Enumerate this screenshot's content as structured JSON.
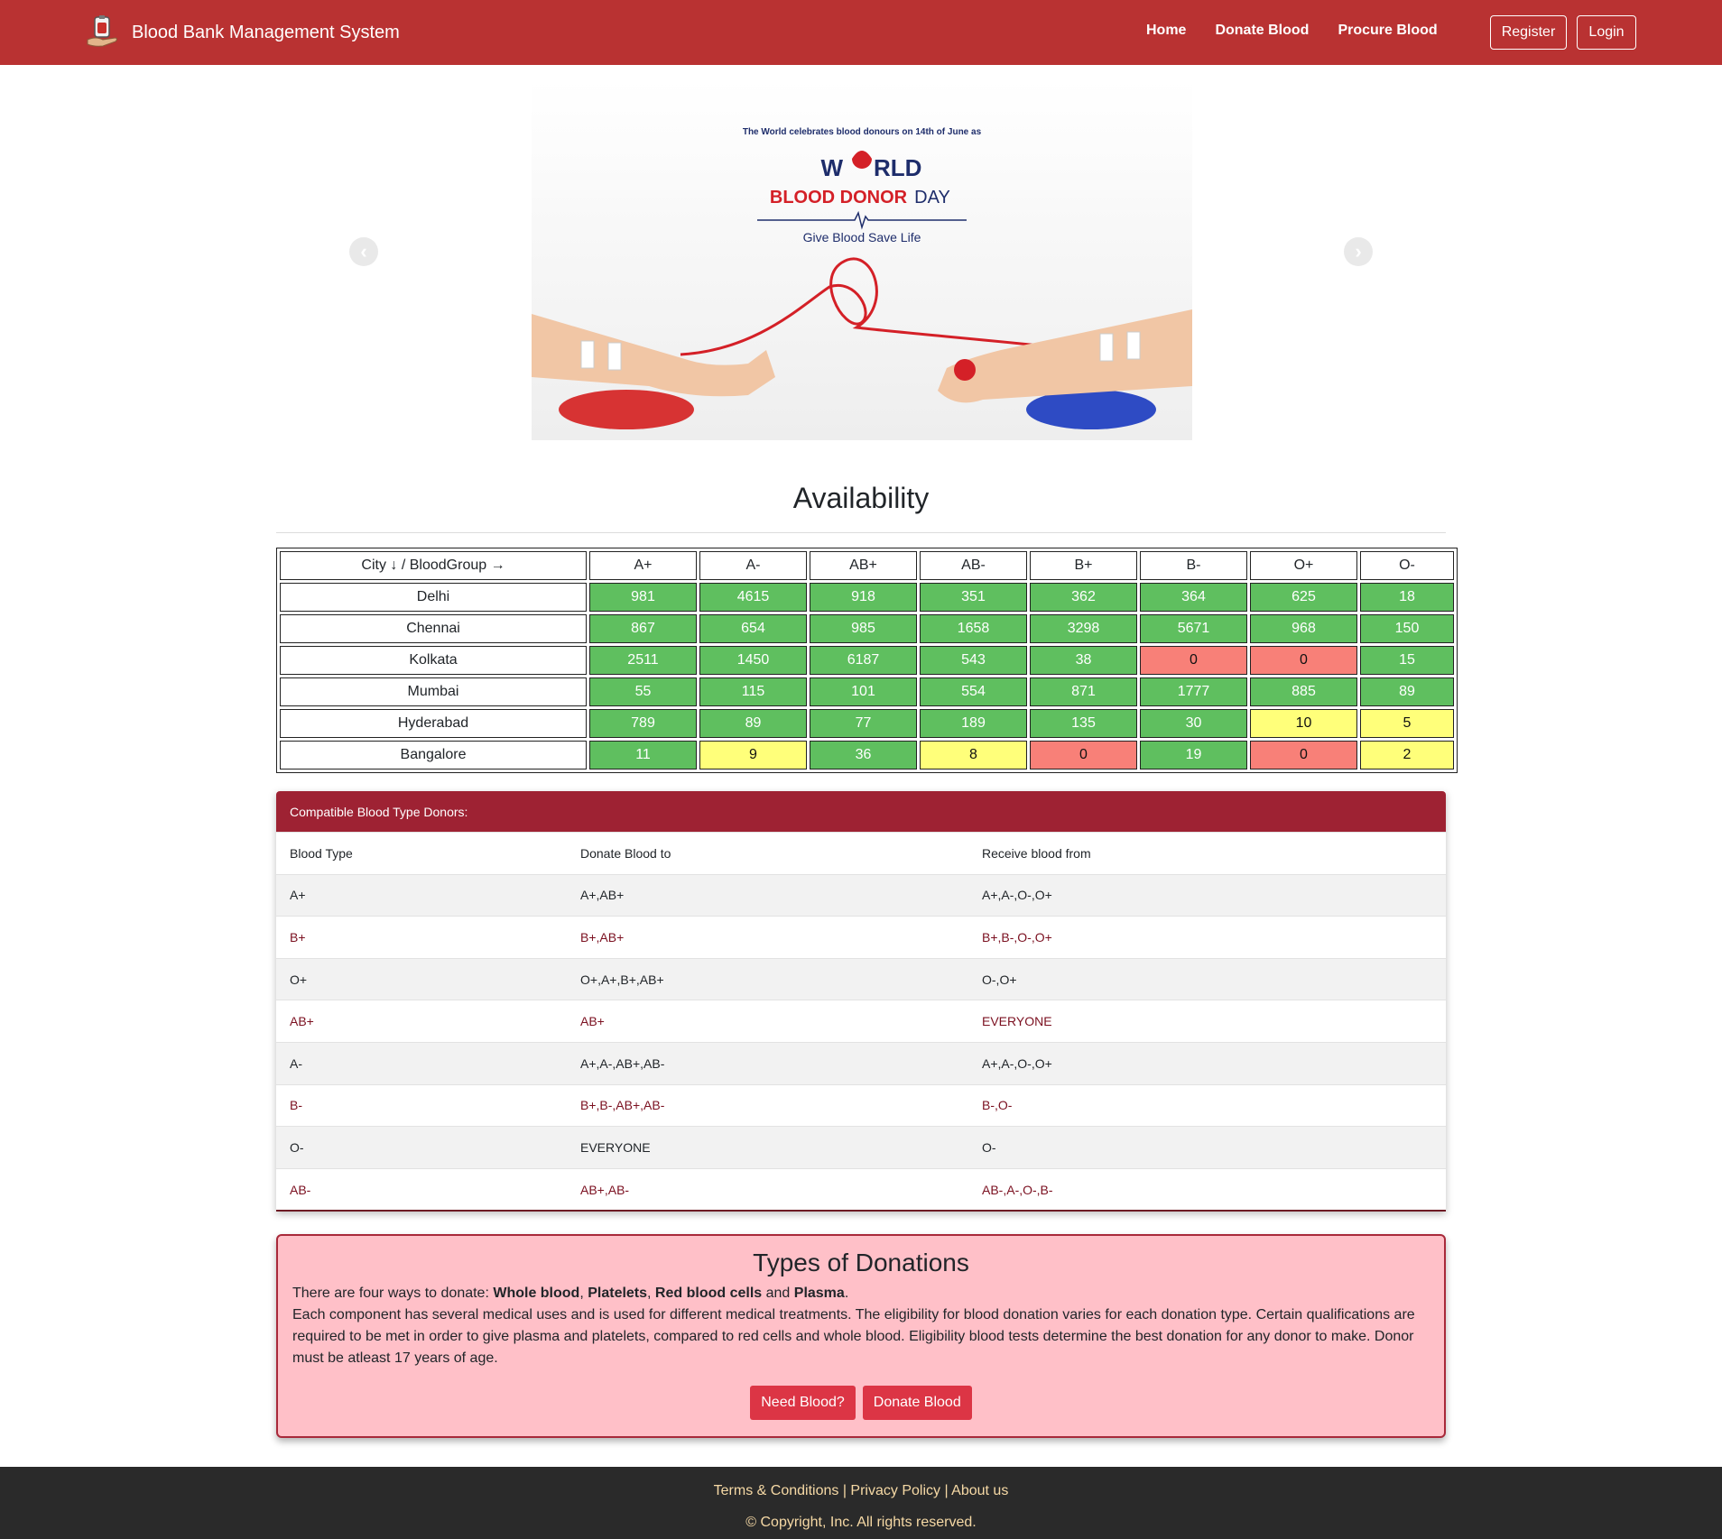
{
  "nav": {
    "brand": "Blood Bank Management System",
    "links": [
      "Home",
      "Donate Blood",
      "Procure Blood"
    ],
    "register": "Register",
    "login": "Login"
  },
  "banner": {
    "tagline": "The World celebrates blood donours on 14th of June as",
    "title_world": "WORLD",
    "title_main": "BLOOD DONOR",
    "title_day": "DAY",
    "slogan": "Give Blood Save Life"
  },
  "availability": {
    "title": "Availability",
    "corner": "City ↓ / BloodGroup →",
    "groups": [
      "A+",
      "A-",
      "AB+",
      "AB-",
      "B+",
      "B-",
      "O+",
      "O-"
    ],
    "rows": [
      {
        "city": "Delhi",
        "values": [
          "981",
          "4615",
          "918",
          "351",
          "362",
          "364",
          "625",
          "18"
        ],
        "status": [
          "g",
          "g",
          "g",
          "g",
          "g",
          "g",
          "g",
          "g"
        ]
      },
      {
        "city": "Chennai",
        "values": [
          "867",
          "654",
          "985",
          "1658",
          "3298",
          "5671",
          "968",
          "150"
        ],
        "status": [
          "g",
          "g",
          "g",
          "g",
          "g",
          "g",
          "g",
          "g"
        ]
      },
      {
        "city": "Kolkata",
        "values": [
          "2511",
          "1450",
          "6187",
          "543",
          "38",
          "0",
          "0",
          "15"
        ],
        "status": [
          "g",
          "g",
          "g",
          "g",
          "g",
          "r",
          "r",
          "g"
        ]
      },
      {
        "city": "Mumbai",
        "values": [
          "55",
          "115",
          "101",
          "554",
          "871",
          "1777",
          "885",
          "89"
        ],
        "status": [
          "g",
          "g",
          "g",
          "g",
          "g",
          "g",
          "g",
          "g"
        ]
      },
      {
        "city": "Hyderabad",
        "values": [
          "789",
          "89",
          "77",
          "189",
          "135",
          "30",
          "10",
          "5"
        ],
        "status": [
          "g",
          "g",
          "g",
          "g",
          "g",
          "g",
          "y",
          "y"
        ]
      },
      {
        "city": "Bangalore",
        "values": [
          "11",
          "9",
          "36",
          "8",
          "0",
          "19",
          "0",
          "2"
        ],
        "status": [
          "g",
          "y",
          "g",
          "y",
          "r",
          "g",
          "r",
          "y"
        ]
      }
    ],
    "colors": {
      "g": "#5fbf5f",
      "y": "#ffff7a",
      "r": "#f88078"
    }
  },
  "compat": {
    "title": "Compatible Blood Type Donors:",
    "headers": [
      "Blood Type",
      "Donate Blood to",
      "Receive blood from"
    ],
    "rows": [
      [
        "A+",
        "A+,AB+",
        "A+,A-,O-,O+"
      ],
      [
        "B+",
        "B+,AB+",
        "B+,B-,O-,O+"
      ],
      [
        "O+",
        "O+,A+,B+,AB+",
        "O-,O+"
      ],
      [
        "AB+",
        "AB+",
        "EVERYONE"
      ],
      [
        "A-",
        "A+,A-,AB+,AB-",
        "A+,A-,O-,O+"
      ],
      [
        "B-",
        "B+,B-,AB+,AB-",
        "B-,O-"
      ],
      [
        "O-",
        "EVERYONE",
        "O-"
      ],
      [
        "AB-",
        "AB+,AB-",
        "AB-,A-,O-,B-"
      ]
    ]
  },
  "types": {
    "title": "Types of Donations",
    "intro": "There are four ways to donate: ",
    "kinds": [
      "Whole blood",
      "Platelets",
      "Red blood cells",
      "Plasma"
    ],
    "body": "Each component has several medical uses and is used for different medical treatments. The eligibility for blood donation varies for each donation type. Certain qualifications are required to be met in order to give plasma and platelets, compared to red cells and whole blood. Eligibility blood tests determine the best donation for any donor to make. Donor must be atleast 17 years of age.",
    "need_btn": "Need Blood?",
    "donate_btn": "Donate Blood"
  },
  "footer": {
    "links": [
      "Terms & Conditions",
      "Privacy Policy",
      "About us"
    ],
    "copyright": "© Copyright, Inc. All rights reserved."
  }
}
